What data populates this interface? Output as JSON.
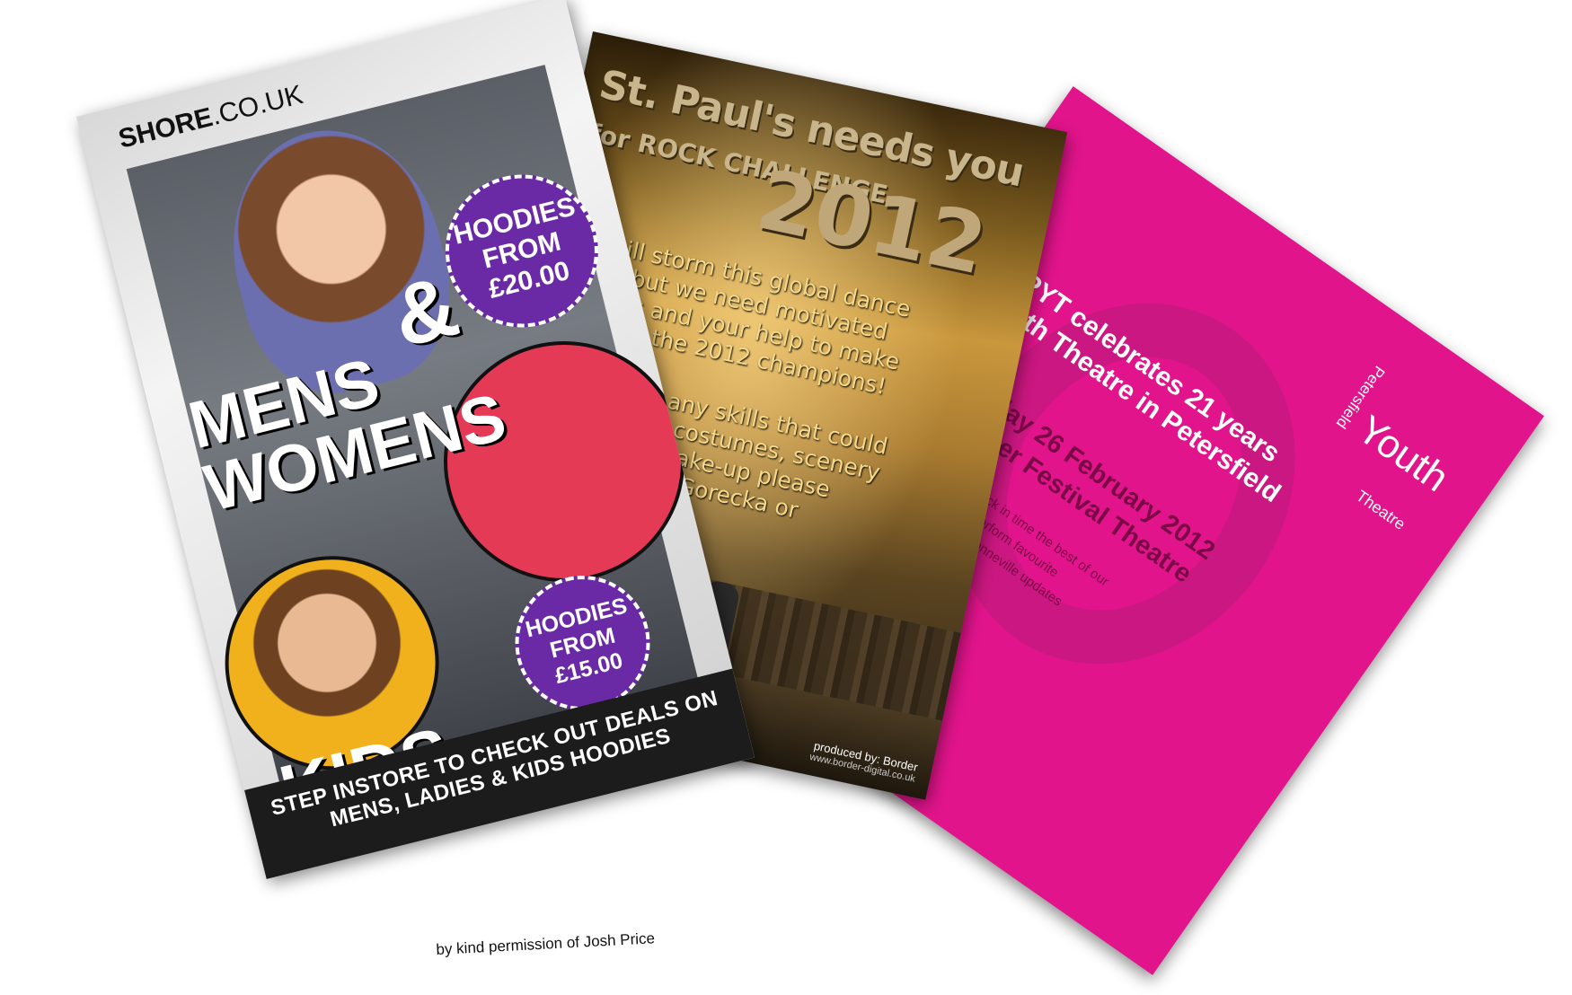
{
  "pink_flyer": {
    "logo_line1": "Petersfield",
    "logo_line2": "Youth",
    "logo_line3": "Theatre",
    "heading": "PYT celebrates 21 years Youth Theatre in Petersfield",
    "date": "Sunday 26 February 2012 Chester Festival Theatre",
    "body": "Join us on a journey back in time the best of our 21 years members will perform favourite workshop leaders Hugh Bonneville updates please keep website",
    "color": "#e2148c"
  },
  "gold_flyer": {
    "title": "St. Paul's needs you",
    "subtitle": "for ROCK CHALLENGE",
    "year": "2012",
    "para1": "We will storm this global dance event but we need motivated dancers and your help to make St. Pauls the 2012 champions!",
    "para2": "If you have any skills that could help us with costumes, scenery or hair and make-up please speak to Miss Gorecka or Dagnell.",
    "credit": "produced by: Border",
    "credit_url": "www.border-digital.co.uk"
  },
  "shore_flyer": {
    "logo_main": "SHORE",
    "logo_suffix": ".CO.UK",
    "amp": "&",
    "mens_womens": "MENS WOMENS",
    "kids": "KIDS",
    "badge1": "HOODIES FROM £20.00",
    "badge2": "HOODIES FROM £15.00",
    "strip": "STEP INSTORE TO CHECK OUT DEALS ON MENS, LADIES & KIDS HOODIES",
    "badge_color": "#6a2aa6"
  },
  "caption": "by kind permission of Josh Price"
}
